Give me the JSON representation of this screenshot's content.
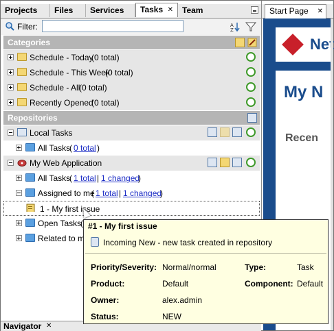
{
  "left_tabs": [
    "Projects",
    "Files",
    "Services",
    "Tasks",
    "Team"
  ],
  "active_tab": "Tasks",
  "filter": {
    "label": "Filter:",
    "value": ""
  },
  "categories_header": "Categories",
  "categories": [
    {
      "label": "Schedule - Today",
      "count": "(0 total)"
    },
    {
      "label": "Schedule - This Week",
      "count": "(0 total)"
    },
    {
      "label": "Schedule - All",
      "count": "(0 total)"
    },
    {
      "label": "Recently Opened",
      "count": "(0 total)"
    }
  ],
  "repositories_header": "Repositories",
  "local_tasks": {
    "label": "Local Tasks",
    "all_tasks": {
      "label": "All Tasks",
      "open": "(",
      "total": "0 total",
      "close": ")"
    }
  },
  "web_app": {
    "label": "My Web Application",
    "all_tasks": {
      "label": "All Tasks",
      "open": "(",
      "total": "1 total",
      "sep": "|",
      "changed": "1 changed",
      "close": ")"
    },
    "assigned": {
      "label": "Assigned to me",
      "open": "(",
      "total": "1 total",
      "sep": "|",
      "changed": "1 changed",
      "close": ")"
    },
    "issue": "1 - My first issue",
    "open_tasks": {
      "label": "Open Tasks",
      "open": "("
    },
    "related": {
      "label": "Related to me"
    }
  },
  "navigator": {
    "label": "Navigator"
  },
  "right": {
    "tab": "Start Page",
    "logo_text": "NetB",
    "big_title": "My N",
    "recent": "Recen"
  },
  "tooltip": {
    "title": "#1 - My first issue",
    "message": "Incoming New - new task created in repository",
    "fields": {
      "priority_label": "Priority/Severity:",
      "priority_value": "Normal/normal",
      "type_label": "Type:",
      "type_value": "Task",
      "product_label": "Product:",
      "product_value": "Default",
      "component_label": "Component:",
      "component_value": "Default",
      "owner_label": "Owner:",
      "owner_value": "alex.admin",
      "status_label": "Status:",
      "status_value": "NEW"
    }
  },
  "icons": {
    "filter": "filter-icon",
    "sort": "sort-icon",
    "funnel": "funnel-icon",
    "new_category": "new-category-icon",
    "edit": "edit-icon",
    "refresh": "refresh-icon",
    "add_repo": "add-repository-icon",
    "new_task": "new-task-icon",
    "new_query": "new-query-icon",
    "search_task": "search-task-icon"
  },
  "colors": {
    "accent_blue": "#1a4c8c",
    "link": "#1c2dc6",
    "section_bg": "#b5b5b5",
    "tooltip_bg": "#ffffe1"
  }
}
